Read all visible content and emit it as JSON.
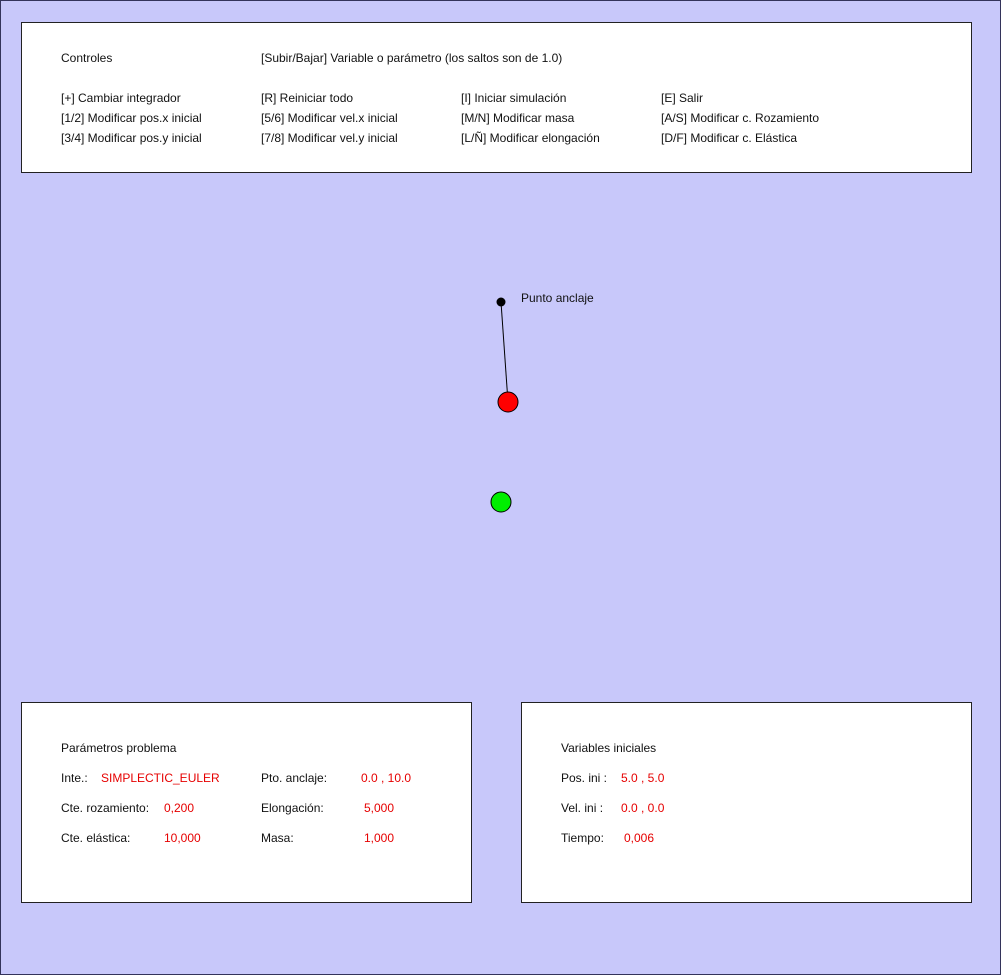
{
  "controls": {
    "title": "Controles",
    "hint": "[Subir/Bajar] Variable o parámetro (los saltos son de 1.0)",
    "rows": [
      [
        "[+] Cambiar integrador",
        "[R] Reiniciar todo",
        "[I] Iniciar simulación",
        "[E] Salir"
      ],
      [
        "[1/2] Modificar pos.x inicial",
        "[5/6] Modificar vel.x inicial",
        "[M/N] Modificar masa",
        "[A/S] Modificar c. Rozamiento"
      ],
      [
        "[3/4] Modificar pos.y inicial",
        "[7/8] Modificar vel.y inicial",
        "[L/Ñ] Modificar elongación",
        "[D/F] Modificar c. Elástica"
      ]
    ]
  },
  "scene": {
    "anchor_label": "Punto anclaje",
    "colors": {
      "anchor": "#000000",
      "mass": "#ff0000",
      "rest": "#00ee00",
      "spring": "#000000"
    }
  },
  "params": {
    "title": "Parámetros problema",
    "integrator_label": "Inte.:",
    "integrator_value": "SIMPLECTIC_EULER",
    "anchor_label": "Pto. anclaje:",
    "anchor_value": "0.0 , 10.0",
    "friction_label": "Cte. rozamiento:",
    "friction_value": "0,200",
    "elongation_label": "Elongación:",
    "elongation_value": "5,000",
    "elastic_label": "Cte. elástica:",
    "elastic_value": "10,000",
    "mass_label": "Masa:",
    "mass_value": "1,000"
  },
  "initial": {
    "title": "Variables iniciales",
    "pos_label": "Pos. ini :",
    "pos_value": "5.0 , 5.0",
    "vel_label": "Vel. ini :",
    "vel_value": "0.0 , 0.0",
    "time_label": "Tiempo:",
    "time_value": "0,006"
  },
  "theme": {
    "background": "#c8c8fa",
    "value_color": "#e60000"
  }
}
